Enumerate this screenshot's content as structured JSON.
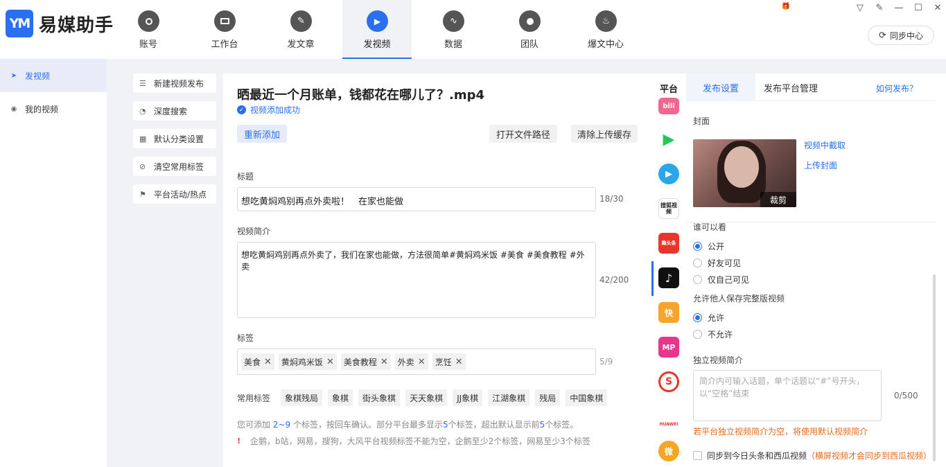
{
  "app": {
    "name": "易媒助手",
    "logo_mark": "YM"
  },
  "nav": {
    "tabs": [
      {
        "label": "账号",
        "icon": "user-icon",
        "glyph": "👤"
      },
      {
        "label": "工作台",
        "icon": "monitor-icon",
        "glyph": "▭"
      },
      {
        "label": "发文章",
        "icon": "feather-icon",
        "glyph": "✎"
      },
      {
        "label": "发视频",
        "icon": "play-icon",
        "glyph": "▶",
        "active": true
      },
      {
        "label": "数据",
        "icon": "chart-icon",
        "glyph": "∿"
      },
      {
        "label": "团队",
        "icon": "team-icon",
        "glyph": "👥"
      },
      {
        "label": "爆文中心",
        "icon": "flame-icon",
        "glyph": "🔥"
      }
    ]
  },
  "window": {
    "min": "—",
    "max": "☐",
    "close": "✕",
    "dropdown": "▽",
    "edit": "✎"
  },
  "sync_button": "同步中心",
  "sidebar": {
    "items": [
      {
        "label": "发视频",
        "active": true
      },
      {
        "label": "我的视频"
      }
    ]
  },
  "tools": {
    "items": [
      "新建视频发布",
      "深度搜索",
      "默认分类设置",
      "清空常用标签",
      "平台活动/热点"
    ]
  },
  "main": {
    "file_name": "晒最近一个月账单，钱都花在哪儿了？.mp4",
    "upload_status": "视频添加成功",
    "readd_button": "重新添加",
    "open_path_button": "打开文件路径",
    "clear_cache_button": "清除上传缓存",
    "title_label": "标题",
    "title_value": "想吃黄焖鸡别再点外卖啦！　在家也能做",
    "title_count": "18/30",
    "desc_label": "视频简介",
    "desc_value": "想吃黄焖鸡别再点外卖了，我们在家也能做，方法很简单#黄焖鸡米饭 #美食 #美食教程 #外卖",
    "desc_count": "42/200",
    "tags_label": "标签",
    "tags": [
      "美食",
      "黄焖鸡米饭",
      "美食教程",
      "外卖",
      "烹饪"
    ],
    "tags_count": "5/9",
    "common_tags_label": "常用标签",
    "common_tags": [
      "象棋残局",
      "象棋",
      "街头象棋",
      "天天象棋",
      "JJ象棋",
      "江湖象棋",
      "残局",
      "中国象棋"
    ],
    "hint1_a": "您可添加 ",
    "hint1_b": "2~9",
    "hint1_c": " 个标签，按回车确认。部分平台最多显示",
    "hint1_d": "5",
    "hint1_e": "个标签，超出默认显示前",
    "hint1_f": "5",
    "hint1_g": "个标签。",
    "hint2": "企鹅，b站，网易，搜狗，大风平台视频标签不能为空，企鹅至少2个标签，网易至少3个标签"
  },
  "platforms": {
    "header": "平台",
    "items": [
      {
        "name": "bilibili",
        "label": "bili",
        "color": "#f0688f"
      },
      {
        "name": "iqiyi-video",
        "label": "▶",
        "color": "#23c75a"
      },
      {
        "name": "haokan-video",
        "label": "▶",
        "color": "#2aa7e8"
      },
      {
        "name": "sohu-video",
        "label": "搜狐视频",
        "color": "#ffffff"
      },
      {
        "name": "qutoutiao",
        "label": "趣头条",
        "color": "#e8362a"
      },
      {
        "name": "douyin",
        "label": "♪",
        "color": "#111111"
      },
      {
        "name": "kuaishou",
        "label": "快",
        "color": "#f7a42b"
      },
      {
        "name": "meipai",
        "label": "MP",
        "color": "#e8368c"
      },
      {
        "name": "sohu",
        "label": "S",
        "color": "#e8362a"
      },
      {
        "name": "huawei",
        "label": "HUAWEI",
        "color": "#ffffff"
      },
      {
        "name": "weibo",
        "label": "微",
        "color": "#f5a623"
      }
    ]
  },
  "settings": {
    "tab_publish": "发布设置",
    "tab_manage": "发布平台管理",
    "how_to": "如何发布？",
    "cover_label": "封面",
    "capture_link": "视频中截取",
    "upload_cover_link": "上传封面",
    "crop_label": "裁剪",
    "visibility_label": "谁可以看",
    "visibility_options": [
      "公开",
      "好友可见",
      "仅自己可见"
    ],
    "visibility_selected": 0,
    "save_label": "允许他人保存完整版视频",
    "save_options": [
      "允许",
      "不允许"
    ],
    "save_selected": 0,
    "indep_desc_label": "独立视频简介",
    "indep_desc_placeholder": "简介内可输入话题，单个话题以“#”号开头，以“空格”结束",
    "indep_desc_count": "0/500",
    "indep_desc_warning": "若平台独立视频简介为空，将使用默认视频简介",
    "sync_label": "同步到今日头条和西瓜视频",
    "sync_note": "（横屏视频才会同步到西瓜视频）"
  }
}
